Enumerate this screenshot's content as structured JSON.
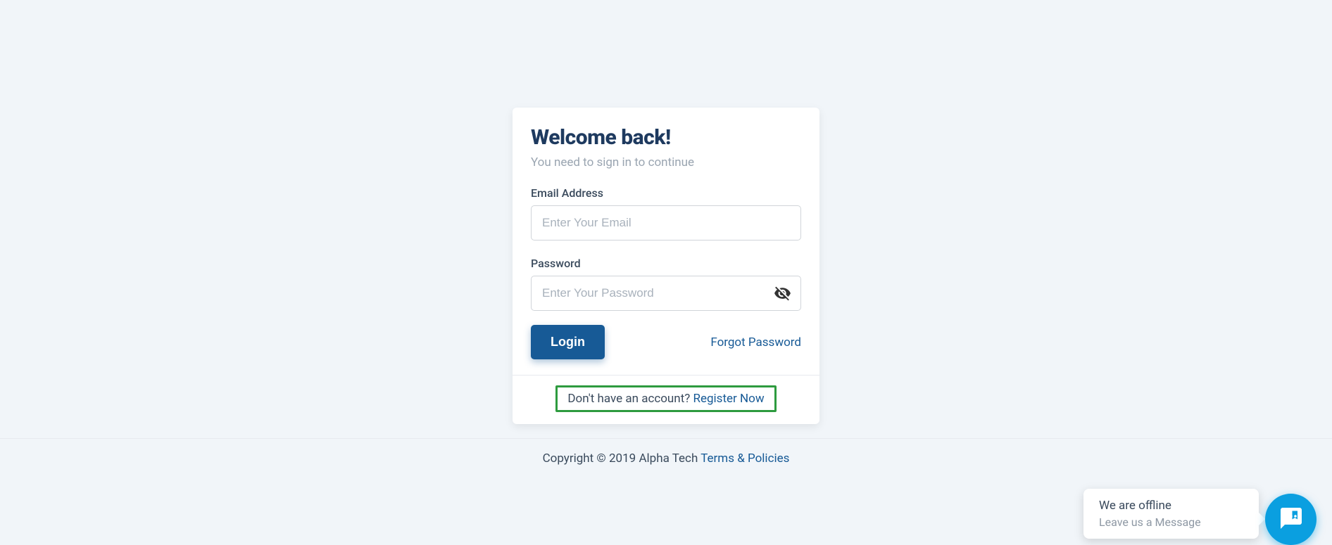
{
  "login": {
    "title": "Welcome back!",
    "subtitle": "You need to sign in to continue",
    "email_label": "Email Address",
    "email_placeholder": "Enter Your Email",
    "password_label": "Password",
    "password_placeholder": "Enter Your Password",
    "login_button": "Login",
    "forgot_link": "Forgot Password",
    "register_prompt": "Don't have an account? ",
    "register_link": "Register Now"
  },
  "footer": {
    "copyright": "Copyright © 2019 Alpha Tech ",
    "terms_link": "Terms & Policies"
  },
  "chat": {
    "status": "We are offline",
    "prompt": "Leave us a Message"
  }
}
